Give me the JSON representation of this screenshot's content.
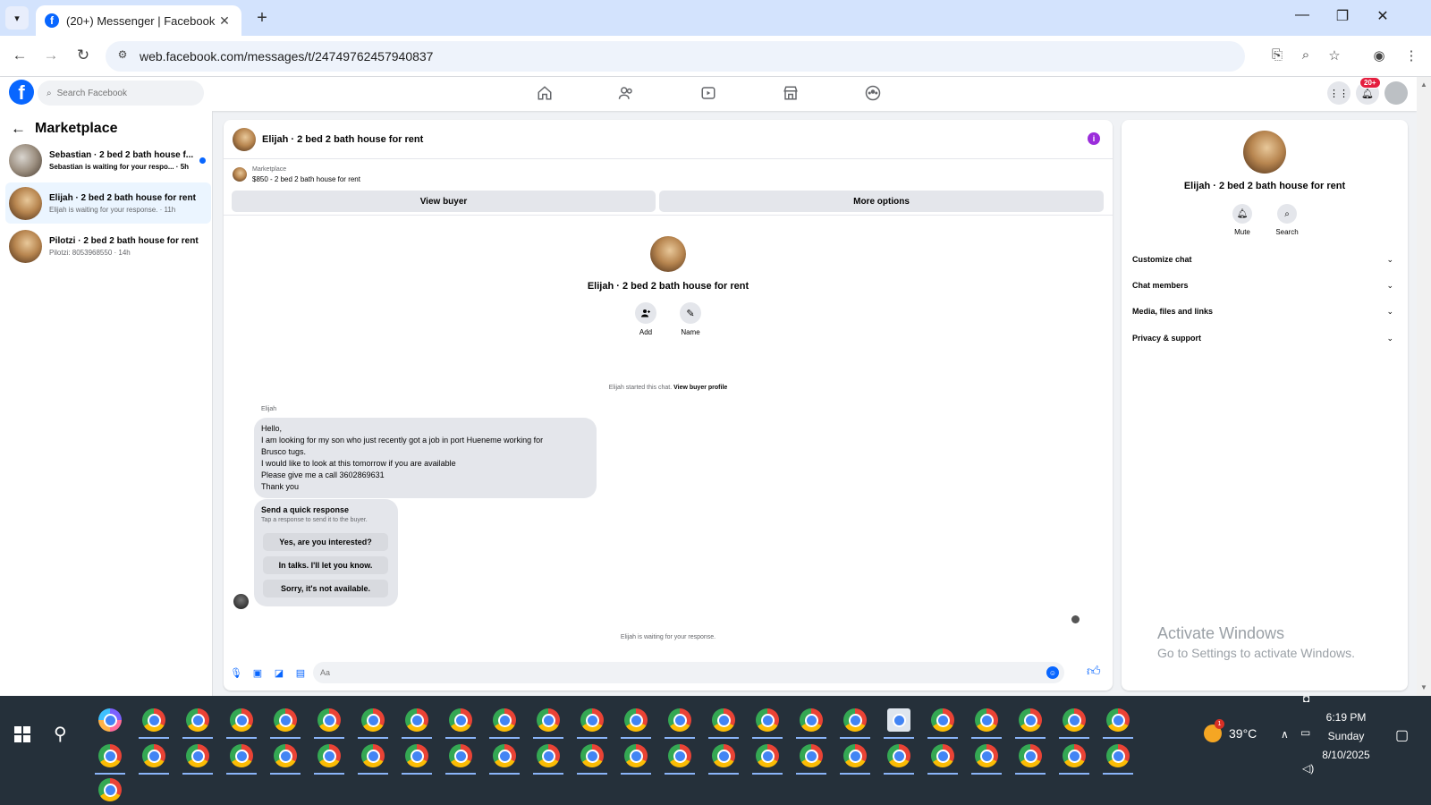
{
  "browser": {
    "tab_title": "(20+) Messenger | Facebook",
    "url": "web.facebook.com/messages/t/24749762457940837"
  },
  "fb": {
    "search_placeholder": "Search Facebook",
    "notif_badge": "20+"
  },
  "sidebar": {
    "title": "Marketplace",
    "conversations": [
      {
        "name": "Sebastian · 2 bed 2 bath house f...",
        "sub": "Sebastian is waiting for your respo... · 5h",
        "unread": true
      },
      {
        "name": "Elijah · 2 bed 2 bath house for rent",
        "sub": "Elijah is waiting for your response. · 11h",
        "active": true
      },
      {
        "name": "Pilotzi · 2 bed 2 bath house for rent",
        "sub": "Pilotzi: 8053968550 · 14h"
      }
    ]
  },
  "chat": {
    "title": "Elijah · 2 bed 2 bath house for rent",
    "listing_label": "Marketplace",
    "listing_price": "$850 - 2 bed 2 bath house for rent",
    "view_buyer": "View buyer",
    "more_options": "More options",
    "profile_name": "Elijah · 2 bed 2 bath house for rent",
    "add_label": "Add",
    "name_label": "Name",
    "started_text": "Elijah started this chat.",
    "view_buyer_profile": "View buyer profile",
    "sender": "Elijah",
    "message_lines": [
      "Hello,",
      "I am looking for my son who just recently got a job in port Hueneme working for",
      "Brusco tugs.",
      "I would like to look at this tomorrow if you are available",
      "Please give me a call 3602869631",
      "Thank you"
    ],
    "quick_title": "Send a quick response",
    "quick_sub": "Tap a response to send it to the buyer.",
    "quick_responses": [
      "Yes, are you interested?",
      "In talks. I'll let you know.",
      "Sorry, it's not available."
    ],
    "waiting_text": "Elijah is waiting for your response.",
    "composer_placeholder": "Aa"
  },
  "right_panel": {
    "name": "Elijah · 2 bed 2 bath house for rent",
    "mute": "Mute",
    "search": "Search",
    "sections": [
      "Customize chat",
      "Chat members",
      "Media, files and links",
      "Privacy & support"
    ]
  },
  "watermark": {
    "line1": "Activate Windows",
    "line2": "Go to Settings to activate Windows."
  },
  "taskbar": {
    "temperature": "39°C",
    "weather_badge": "1",
    "time": "6:19 PM",
    "day": "Sunday",
    "date": "8/10/2025"
  },
  "colors": {
    "fb_blue": "#0866ff",
    "active_row": "#ebf5ff",
    "taskbar": "#25303a"
  }
}
